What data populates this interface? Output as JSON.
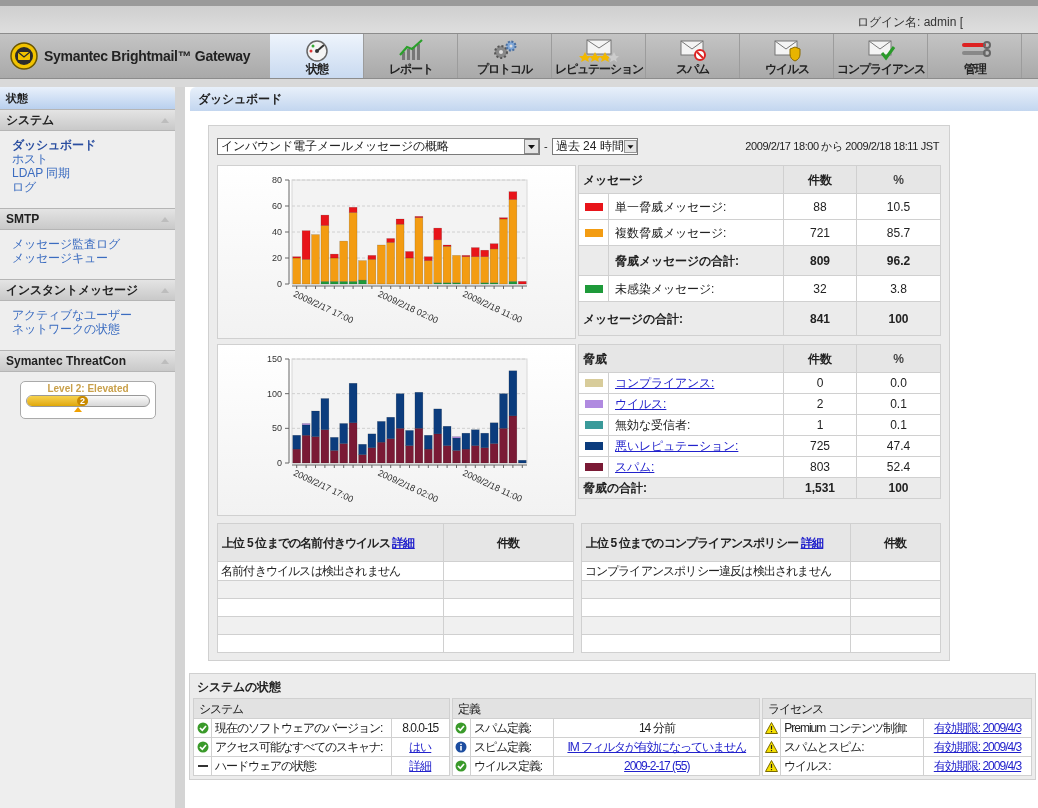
{
  "header": {
    "login": "ログイン名: admin [",
    "product": "Symantec Brightmail™ Gateway",
    "tabs": [
      {
        "label": "状態",
        "selected": true
      },
      {
        "label": "レポート",
        "selected": false
      },
      {
        "label": "プロトコル",
        "selected": false
      },
      {
        "label": "レピュテーション",
        "selected": false
      },
      {
        "label": "スパム",
        "selected": false
      },
      {
        "label": "ウイルス",
        "selected": false
      },
      {
        "label": "コンプライアンス",
        "selected": false
      },
      {
        "label": "管理",
        "selected": false
      }
    ]
  },
  "sidebar": {
    "title": "状態",
    "sections": [
      {
        "kind": "links",
        "title": "システム",
        "items": [
          {
            "label": "ダッシュボード",
            "selected": true
          },
          {
            "label": "ホスト",
            "selected": false
          },
          {
            "label": "LDAP 同期",
            "selected": false
          },
          {
            "label": "ログ",
            "selected": false
          }
        ]
      },
      {
        "kind": "links",
        "title": "SMTP",
        "items": [
          {
            "label": "メッセージ監査ログ",
            "selected": false
          },
          {
            "label": "メッセージキュー",
            "selected": false
          }
        ]
      },
      {
        "kind": "links",
        "title": "インスタントメッセージ",
        "items": [
          {
            "label": "アクティブなユーザー",
            "selected": false
          },
          {
            "label": "ネットワークの状態",
            "selected": false
          }
        ]
      },
      {
        "kind": "threatcon",
        "title": "Symantec ThreatCon",
        "label": "Level 2: Elevated",
        "value": "2",
        "level": 0.5
      }
    ]
  },
  "page_title": "ダッシュボード",
  "report_select": "インバウンド電子メールメッセージの概略",
  "separator": "-",
  "range_select": "過去 24 時間",
  "date_range": "2009/2/17 18:00 から 2009/2/18 18:11 JST",
  "messages": {
    "chart_data": {
      "type": "bar",
      "stacked": true,
      "categories": [
        "2009/2/17 17:00",
        null,
        null,
        null,
        null,
        null,
        null,
        null,
        null,
        "2009/2/18 02:00",
        null,
        null,
        null,
        null,
        null,
        null,
        null,
        null,
        "2009/2/18 11:00",
        null,
        null,
        null,
        null,
        null,
        null
      ],
      "ylim": [
        0,
        80
      ],
      "yticks": [
        0,
        20,
        40,
        60,
        80
      ],
      "grid": true,
      "series": [
        {
          "color": "#1e9a3a",
          "values": [
            0,
            0,
            0,
            2,
            2,
            2,
            2,
            3,
            0,
            0,
            0,
            0,
            0,
            0,
            0,
            1,
            1,
            1,
            0,
            0,
            1,
            1,
            0,
            2,
            0
          ]
        },
        {
          "color": "#f39c12",
          "values": [
            20,
            19,
            38,
            43,
            18,
            31,
            53,
            15,
            19,
            30,
            32,
            46,
            20,
            51,
            18,
            33,
            28,
            21,
            21,
            21,
            20,
            26,
            50,
            63,
            0
          ]
        },
        {
          "color": "#e8141a",
          "values": [
            1,
            22,
            0,
            8,
            3,
            0,
            4,
            0,
            3,
            0,
            3,
            4,
            5,
            1,
            3,
            9,
            1,
            0,
            1,
            7,
            5,
            4,
            1,
            6,
            2
          ]
        }
      ]
    },
    "columns": [
      "メッセージ",
      "件数",
      "%"
    ],
    "rows": [
      {
        "kind": "item",
        "color": "#e8141a",
        "label": "単一脅威メッセージ:",
        "count": "88",
        "percent": "10.5"
      },
      {
        "kind": "item",
        "color": "#f39c12",
        "label": "複数脅威メッセージ:",
        "count": "721",
        "percent": "85.7"
      },
      {
        "kind": "subtotal",
        "label": "脅威メッセージの合計:",
        "count": "809",
        "percent": "96.2"
      },
      {
        "kind": "item",
        "color": "#1e9a3a",
        "label": "未感染メッセージ:",
        "count": "32",
        "percent": "3.8"
      },
      {
        "kind": "total",
        "label": "メッセージの合計:",
        "count": "841",
        "percent": "100"
      }
    ]
  },
  "threats": {
    "chart_data": {
      "type": "bar",
      "stacked": true,
      "categories": [
        "2009/2/17 17:00",
        null,
        null,
        null,
        null,
        null,
        null,
        null,
        null,
        "2009/2/18 02:00",
        null,
        null,
        null,
        null,
        null,
        null,
        null,
        null,
        "2009/2/18 11:00",
        null,
        null,
        null,
        null,
        null,
        null
      ],
      "ylim": [
        0,
        150
      ],
      "yticks": [
        0,
        50,
        100,
        150
      ],
      "grid": true,
      "series": [
        {
          "color": "#7a1a35",
          "values": [
            20,
            40,
            38,
            48,
            18,
            28,
            58,
            12,
            22,
            30,
            35,
            50,
            25,
            50,
            20,
            42,
            25,
            18,
            20,
            25,
            22,
            28,
            50,
            68,
            0
          ]
        },
        {
          "color": "#0b3c7d",
          "values": [
            20,
            15,
            37,
            45,
            19,
            29,
            57,
            15,
            20,
            30,
            31,
            50,
            22,
            52,
            20,
            36,
            28,
            18,
            23,
            23,
            21,
            30,
            50,
            65,
            4
          ]
        },
        {
          "color": "#b08ae0",
          "values": [
            0,
            2,
            0,
            0,
            0,
            0,
            0,
            0,
            0,
            0,
            0,
            0,
            0,
            0,
            0,
            0,
            0,
            2,
            0,
            0,
            0,
            0,
            0,
            0,
            0
          ]
        }
      ]
    },
    "columns": [
      "脅威",
      "件数",
      "%"
    ],
    "rows": [
      {
        "kind": "item",
        "color": "#d8cc9a",
        "label": "コンプライアンス:",
        "link": true,
        "count": "0",
        "percent": "0.0"
      },
      {
        "kind": "item",
        "color": "#b08ae0",
        "label": "ウイルス:",
        "link": true,
        "count": "2",
        "percent": "0.1"
      },
      {
        "kind": "item",
        "color": "#3a9a9a",
        "label": "無効な受信者:",
        "link": false,
        "count": "1",
        "percent": "0.1"
      },
      {
        "kind": "item",
        "color": "#0b3c7d",
        "label": "悪いレピュテーション:",
        "link": true,
        "count": "725",
        "percent": "47.4"
      },
      {
        "kind": "item",
        "color": "#7a1a35",
        "label": "スパム:",
        "link": true,
        "count": "803",
        "percent": "52.4"
      },
      {
        "kind": "total",
        "label": "脅威の合計:",
        "count": "1,531",
        "percent": "100"
      }
    ]
  },
  "top_lists": [
    {
      "title": "上位 5 位までの名前付きウイルス",
      "link": "詳細",
      "count_header": "件数",
      "rows": [
        "名前付きウイルスは検出されません"
      ]
    },
    {
      "title": "上位 5 位までのコンプライアンスポリシー",
      "link": "詳細",
      "count_header": "件数",
      "rows": [
        "コンプライアンスポリシー違反は検出されません"
      ]
    }
  ],
  "system_status": {
    "title": "システムの状態",
    "panels": [
      {
        "title": "システム",
        "rows": [
          {
            "kind": "ok",
            "label": "現在のソフトウェアのバージョン:",
            "value": "8.0.0-15",
            "link": false
          },
          {
            "kind": "ok",
            "label": "アクセス可能なすべてのスキャナ:",
            "value": "はい",
            "link": true
          },
          {
            "kind": "none",
            "label": "ハードウェアの状態:",
            "value": "詳細",
            "link": true
          }
        ]
      },
      {
        "title": "定義",
        "rows": [
          {
            "kind": "ok",
            "label": "スパム定義:",
            "value": "14 分前",
            "link": false
          },
          {
            "kind": "info",
            "label": "スピム定義:",
            "value": "IM フィルタが有効になっていません",
            "link": true
          },
          {
            "kind": "ok",
            "label": "ウイルス定義:",
            "value": "2009-2-17 (55)",
            "link": true
          }
        ]
      },
      {
        "title": "ライセンス",
        "rows": [
          {
            "kind": "warning",
            "label": "Premium コンテンツ制御:",
            "value": "有効期限: 2009/4/3",
            "link": true
          },
          {
            "kind": "warning",
            "label": "スパムとスピム:",
            "value": "有効期限: 2009/4/3",
            "link": true
          },
          {
            "kind": "warning",
            "label": "ウイルス:",
            "value": "有効期限: 2009/4/3",
            "link": true
          }
        ]
      }
    ]
  }
}
